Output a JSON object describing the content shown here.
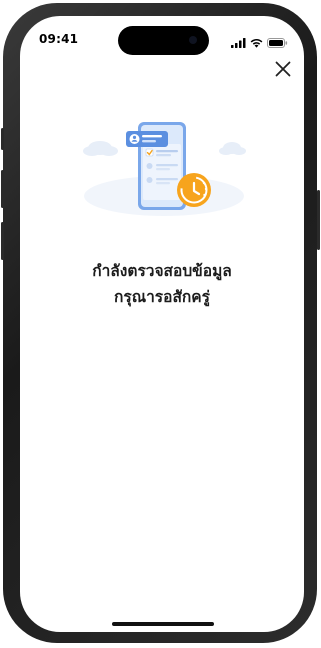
{
  "status_bar": {
    "time": "09:41",
    "icons": [
      "cellular-signal-icon",
      "wifi-icon",
      "battery-icon"
    ]
  },
  "header": {
    "close_icon": "close-icon"
  },
  "illustration": {
    "icon": "document-verification-clock-icon",
    "colors": {
      "phone": "#5b8fe0",
      "card": "#e9f1fc",
      "clock": "#f7a41d",
      "cloud": "#e7eef8"
    }
  },
  "message": {
    "line1": "กำลังตรวจสอบข้อมูล",
    "line2": "กรุณารอสักครู่"
  }
}
